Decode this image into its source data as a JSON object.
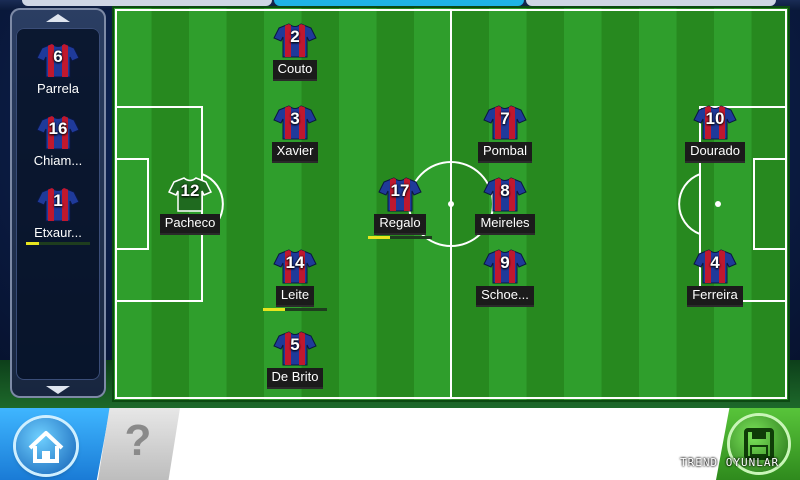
{
  "colors": {
    "shirt_blue": "#1f3a9a",
    "shirt_red": "#c0182e",
    "keeper_green": "#1f6a1f",
    "pitch_light": "#2f9e2c",
    "pitch_dark": "#27891f"
  },
  "bench": {
    "players": [
      {
        "number": "6",
        "name": "Parrela",
        "progress": 0
      },
      {
        "number": "16",
        "name": "Chiam...",
        "progress": 0
      },
      {
        "number": "1",
        "name": "Etxaur...",
        "progress": 0.2
      }
    ]
  },
  "pitch": {
    "players": [
      {
        "number": "2",
        "name": "Couto",
        "progress": 0
      },
      {
        "number": "3",
        "name": "Xavier",
        "progress": 0
      },
      {
        "number": "12",
        "name": "Pacheco",
        "progress": 0,
        "role": "goalkeeper"
      },
      {
        "number": "14",
        "name": "Leite",
        "progress": 0.35
      },
      {
        "number": "5",
        "name": "De Brito",
        "progress": 0
      },
      {
        "number": "17",
        "name": "Regalo",
        "progress": 0.35
      },
      {
        "number": "7",
        "name": "Pombal",
        "progress": 0
      },
      {
        "number": "8",
        "name": "Meireles",
        "progress": 0
      },
      {
        "number": "9",
        "name": "Schoe...",
        "progress": 0
      },
      {
        "number": "10",
        "name": "Dourado",
        "progress": 0
      },
      {
        "number": "4",
        "name": "Ferreira",
        "progress": 0
      }
    ]
  },
  "bottom": {
    "home_icon": "home-icon",
    "help_label": "?",
    "save_icon": "save-icon",
    "watermark": "TREND OYUNLAR"
  }
}
